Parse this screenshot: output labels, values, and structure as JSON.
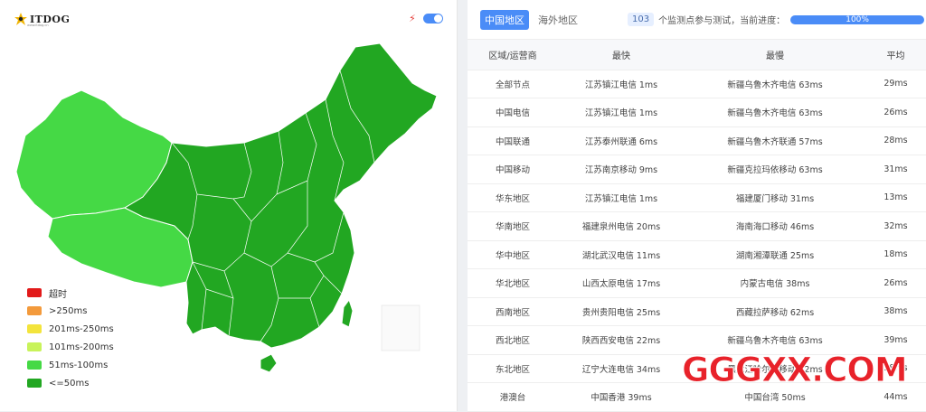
{
  "logo": {
    "text": "ITDOG",
    "subtext": "www.itdog.cn"
  },
  "legend": [
    {
      "label": "超时",
      "color": "#e21a1a"
    },
    {
      "label": ">250ms",
      "color": "#f39a3c"
    },
    {
      "label": "201ms-250ms",
      "color": "#f3e43c"
    },
    {
      "label": "101ms-200ms",
      "color": "#c8f35a"
    },
    {
      "label": "51ms-100ms",
      "color": "#45d945"
    },
    {
      "label": "<=50ms",
      "color": "#22a722"
    }
  ],
  "tabs": [
    {
      "label": "中国地区",
      "active": true
    },
    {
      "label": "海外地区",
      "active": false
    }
  ],
  "status": {
    "count": "103",
    "text": "个监测点参与测试，当前进度：",
    "progress_label": "100%",
    "progress": 1.0
  },
  "table": {
    "headers": [
      "区域/运营商",
      "最快",
      "最慢",
      "平均"
    ],
    "rows": [
      [
        "全部节点",
        "江苏镇江电信 1ms",
        "新疆乌鲁木齐电信 63ms",
        "29ms"
      ],
      [
        "中国电信",
        "江苏镇江电信 1ms",
        "新疆乌鲁木齐电信 63ms",
        "26ms"
      ],
      [
        "中国联通",
        "江苏泰州联通 6ms",
        "新疆乌鲁木齐联通 57ms",
        "28ms"
      ],
      [
        "中国移动",
        "江苏南京移动 9ms",
        "新疆克拉玛依移动 63ms",
        "31ms"
      ],
      [
        "华东地区",
        "江苏镇江电信 1ms",
        "福建厦门移动 31ms",
        "13ms"
      ],
      [
        "华南地区",
        "福建泉州电信 20ms",
        "海南海口移动 46ms",
        "32ms"
      ],
      [
        "华中地区",
        "湖北武汉电信 11ms",
        "湖南湘潭联通 25ms",
        "18ms"
      ],
      [
        "华北地区",
        "山西太原电信 17ms",
        "内蒙古电信 38ms",
        "26ms"
      ],
      [
        "西南地区",
        "贵州贵阳电信 25ms",
        "西藏拉萨移动 62ms",
        "38ms"
      ],
      [
        "西北地区",
        "陕西西安电信 22ms",
        "新疆乌鲁木齐电信 63ms",
        "39ms"
      ],
      [
        "东北地区",
        "辽宁大连电信 34ms",
        "黑龙江哈尔滨移动 42ms",
        "38ms"
      ],
      [
        "港澳台",
        "中国香港 39ms",
        "中国台湾 50ms",
        "44ms"
      ]
    ]
  },
  "watermark": "GGGXX.COM"
}
